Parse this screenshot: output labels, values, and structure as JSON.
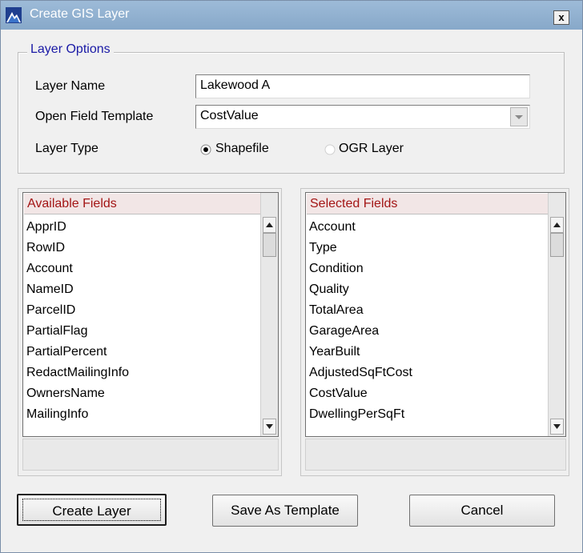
{
  "window": {
    "title": "Create GIS Layer",
    "close_label": "x"
  },
  "layer_options": {
    "legend": "Layer Options",
    "layer_name_label": "Layer Name",
    "layer_name_value": "Lakewood A",
    "field_template_label": "Open Field Template",
    "field_template_value": "CostValue",
    "layer_type_label": "Layer Type",
    "layer_type_options": [
      {
        "label": "Shapefile",
        "selected": true
      },
      {
        "label": "OGR Layer",
        "selected": false
      }
    ]
  },
  "available_fields": {
    "header": "Available Fields",
    "items": [
      "ApprID",
      "RowID",
      "Account",
      "NameID",
      "ParcelID",
      "PartialFlag",
      "PartialPercent",
      "RedactMailingInfo",
      "OwnersName",
      "MailingInfo"
    ]
  },
  "selected_fields": {
    "header": "Selected Fields",
    "items": [
      "Account",
      "Type",
      "Condition",
      "Quality",
      "TotalArea",
      "GarageArea",
      "YearBuilt",
      "AdjustedSqFtCost",
      "CostValue",
      "DwellingPerSqFt"
    ]
  },
  "buttons": {
    "create_layer": "Create Layer",
    "save_template": "Save As Template",
    "cancel": "Cancel"
  },
  "colors": {
    "titlebar": "#87a8c9",
    "group_legend": "#1a1aa6",
    "list_header_text": "#a31515"
  }
}
